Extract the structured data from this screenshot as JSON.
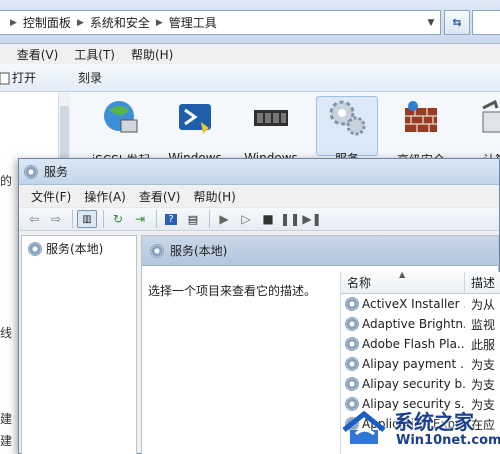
{
  "explorer": {
    "breadcrumb": [
      "控制面板",
      "系统和安全",
      "管理工具"
    ],
    "menu": [
      "查看(V)",
      "工具(T)",
      "帮助(H)"
    ],
    "commands": [
      "打开",
      "刻录"
    ],
    "left_fragments": [
      "的",
      "线",
      "建",
      "建"
    ],
    "icons": [
      {
        "label": "iSCSI 发起",
        "icon": "globe-computer-icon"
      },
      {
        "label": "Windows",
        "icon": "powershell-icon"
      },
      {
        "label": "Windows",
        "icon": "memory-chip-icon"
      },
      {
        "label": "服务",
        "icon": "services-gears-icon"
      },
      {
        "label": "高级安全",
        "icon": "firewall-icon"
      },
      {
        "label": "计算",
        "icon": "computer-management-icon"
      }
    ]
  },
  "services_window": {
    "title": "服务",
    "menu": [
      "文件(F)",
      "操作(A)",
      "查看(V)",
      "帮助(H)"
    ],
    "tree_item": "服务(本地)",
    "detail_header": "服务(本地)",
    "description_prompt": "选择一个项目来查看它的描述。",
    "columns": {
      "name": "名称",
      "desc": "描述"
    },
    "rows": [
      {
        "name": "ActiveX Installer ...",
        "desc": "为从"
      },
      {
        "name": "Adaptive Brightn...",
        "desc": "监视"
      },
      {
        "name": "Adobe Flash Pla...",
        "desc": "此服"
      },
      {
        "name": "Alipay payment ...",
        "desc": "为支"
      },
      {
        "name": "Alipay security b...",
        "desc": "为支"
      },
      {
        "name": "Alipay security s...",
        "desc": "为支"
      },
      {
        "name": "Application Expe...",
        "desc": "在应"
      }
    ]
  },
  "watermark": {
    "title": "系统之家",
    "url": "Win10net.com"
  }
}
